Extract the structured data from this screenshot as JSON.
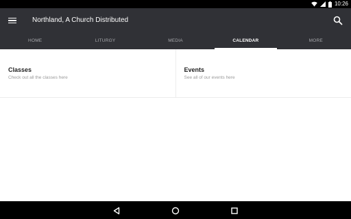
{
  "status_bar": {
    "time": "10:26",
    "icons": [
      "wifi-icon",
      "signal-icon",
      "battery-icon"
    ]
  },
  "app_bar": {
    "menu_icon": "hamburger-menu-icon",
    "title": "Northland, A Church Distributed",
    "search_icon": "search-icon"
  },
  "tabs": [
    {
      "label": "HOME"
    },
    {
      "label": "LITURGY"
    },
    {
      "label": "MEDIA"
    },
    {
      "label": "CALENDAR"
    },
    {
      "label": "MORE"
    }
  ],
  "active_tab": "CALENDAR",
  "cards": [
    {
      "title": "Classes",
      "subtitle": "Check out all the classes here"
    },
    {
      "title": "Events",
      "subtitle": "See all of our events here"
    }
  ],
  "nav_bar": {
    "buttons": [
      "back-icon",
      "home-icon",
      "recents-icon"
    ]
  },
  "colors": {
    "app_bar": "#303136",
    "status_bar": "#000000",
    "tab_inactive": "#a9aaae",
    "tab_active": "#ffffff"
  }
}
